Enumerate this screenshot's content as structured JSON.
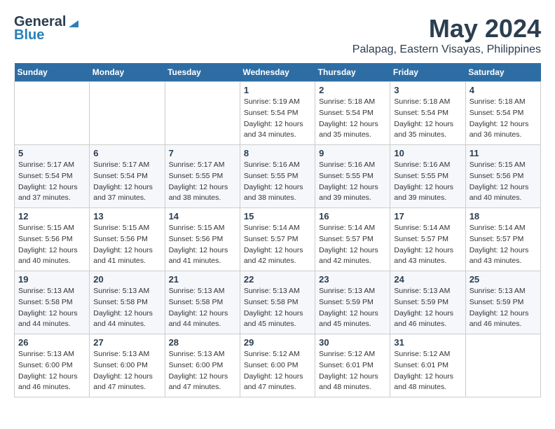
{
  "logo": {
    "general": "General",
    "blue": "Blue"
  },
  "title": "May 2024",
  "subtitle": "Palapag, Eastern Visayas, Philippines",
  "weekdays": [
    "Sunday",
    "Monday",
    "Tuesday",
    "Wednesday",
    "Thursday",
    "Friday",
    "Saturday"
  ],
  "weeks": [
    [
      {
        "day": "",
        "info": ""
      },
      {
        "day": "",
        "info": ""
      },
      {
        "day": "",
        "info": ""
      },
      {
        "day": "1",
        "info": "Sunrise: 5:19 AM\nSunset: 5:54 PM\nDaylight: 12 hours\nand 34 minutes."
      },
      {
        "day": "2",
        "info": "Sunrise: 5:18 AM\nSunset: 5:54 PM\nDaylight: 12 hours\nand 35 minutes."
      },
      {
        "day": "3",
        "info": "Sunrise: 5:18 AM\nSunset: 5:54 PM\nDaylight: 12 hours\nand 35 minutes."
      },
      {
        "day": "4",
        "info": "Sunrise: 5:18 AM\nSunset: 5:54 PM\nDaylight: 12 hours\nand 36 minutes."
      }
    ],
    [
      {
        "day": "5",
        "info": "Sunrise: 5:17 AM\nSunset: 5:54 PM\nDaylight: 12 hours\nand 37 minutes."
      },
      {
        "day": "6",
        "info": "Sunrise: 5:17 AM\nSunset: 5:54 PM\nDaylight: 12 hours\nand 37 minutes."
      },
      {
        "day": "7",
        "info": "Sunrise: 5:17 AM\nSunset: 5:55 PM\nDaylight: 12 hours\nand 38 minutes."
      },
      {
        "day": "8",
        "info": "Sunrise: 5:16 AM\nSunset: 5:55 PM\nDaylight: 12 hours\nand 38 minutes."
      },
      {
        "day": "9",
        "info": "Sunrise: 5:16 AM\nSunset: 5:55 PM\nDaylight: 12 hours\nand 39 minutes."
      },
      {
        "day": "10",
        "info": "Sunrise: 5:16 AM\nSunset: 5:55 PM\nDaylight: 12 hours\nand 39 minutes."
      },
      {
        "day": "11",
        "info": "Sunrise: 5:15 AM\nSunset: 5:56 PM\nDaylight: 12 hours\nand 40 minutes."
      }
    ],
    [
      {
        "day": "12",
        "info": "Sunrise: 5:15 AM\nSunset: 5:56 PM\nDaylight: 12 hours\nand 40 minutes."
      },
      {
        "day": "13",
        "info": "Sunrise: 5:15 AM\nSunset: 5:56 PM\nDaylight: 12 hours\nand 41 minutes."
      },
      {
        "day": "14",
        "info": "Sunrise: 5:15 AM\nSunset: 5:56 PM\nDaylight: 12 hours\nand 41 minutes."
      },
      {
        "day": "15",
        "info": "Sunrise: 5:14 AM\nSunset: 5:57 PM\nDaylight: 12 hours\nand 42 minutes."
      },
      {
        "day": "16",
        "info": "Sunrise: 5:14 AM\nSunset: 5:57 PM\nDaylight: 12 hours\nand 42 minutes."
      },
      {
        "day": "17",
        "info": "Sunrise: 5:14 AM\nSunset: 5:57 PM\nDaylight: 12 hours\nand 43 minutes."
      },
      {
        "day": "18",
        "info": "Sunrise: 5:14 AM\nSunset: 5:57 PM\nDaylight: 12 hours\nand 43 minutes."
      }
    ],
    [
      {
        "day": "19",
        "info": "Sunrise: 5:13 AM\nSunset: 5:58 PM\nDaylight: 12 hours\nand 44 minutes."
      },
      {
        "day": "20",
        "info": "Sunrise: 5:13 AM\nSunset: 5:58 PM\nDaylight: 12 hours\nand 44 minutes."
      },
      {
        "day": "21",
        "info": "Sunrise: 5:13 AM\nSunset: 5:58 PM\nDaylight: 12 hours\nand 44 minutes."
      },
      {
        "day": "22",
        "info": "Sunrise: 5:13 AM\nSunset: 5:58 PM\nDaylight: 12 hours\nand 45 minutes."
      },
      {
        "day": "23",
        "info": "Sunrise: 5:13 AM\nSunset: 5:59 PM\nDaylight: 12 hours\nand 45 minutes."
      },
      {
        "day": "24",
        "info": "Sunrise: 5:13 AM\nSunset: 5:59 PM\nDaylight: 12 hours\nand 46 minutes."
      },
      {
        "day": "25",
        "info": "Sunrise: 5:13 AM\nSunset: 5:59 PM\nDaylight: 12 hours\nand 46 minutes."
      }
    ],
    [
      {
        "day": "26",
        "info": "Sunrise: 5:13 AM\nSunset: 6:00 PM\nDaylight: 12 hours\nand 46 minutes."
      },
      {
        "day": "27",
        "info": "Sunrise: 5:13 AM\nSunset: 6:00 PM\nDaylight: 12 hours\nand 47 minutes."
      },
      {
        "day": "28",
        "info": "Sunrise: 5:13 AM\nSunset: 6:00 PM\nDaylight: 12 hours\nand 47 minutes."
      },
      {
        "day": "29",
        "info": "Sunrise: 5:12 AM\nSunset: 6:00 PM\nDaylight: 12 hours\nand 47 minutes."
      },
      {
        "day": "30",
        "info": "Sunrise: 5:12 AM\nSunset: 6:01 PM\nDaylight: 12 hours\nand 48 minutes."
      },
      {
        "day": "31",
        "info": "Sunrise: 5:12 AM\nSunset: 6:01 PM\nDaylight: 12 hours\nand 48 minutes."
      },
      {
        "day": "",
        "info": ""
      }
    ]
  ]
}
